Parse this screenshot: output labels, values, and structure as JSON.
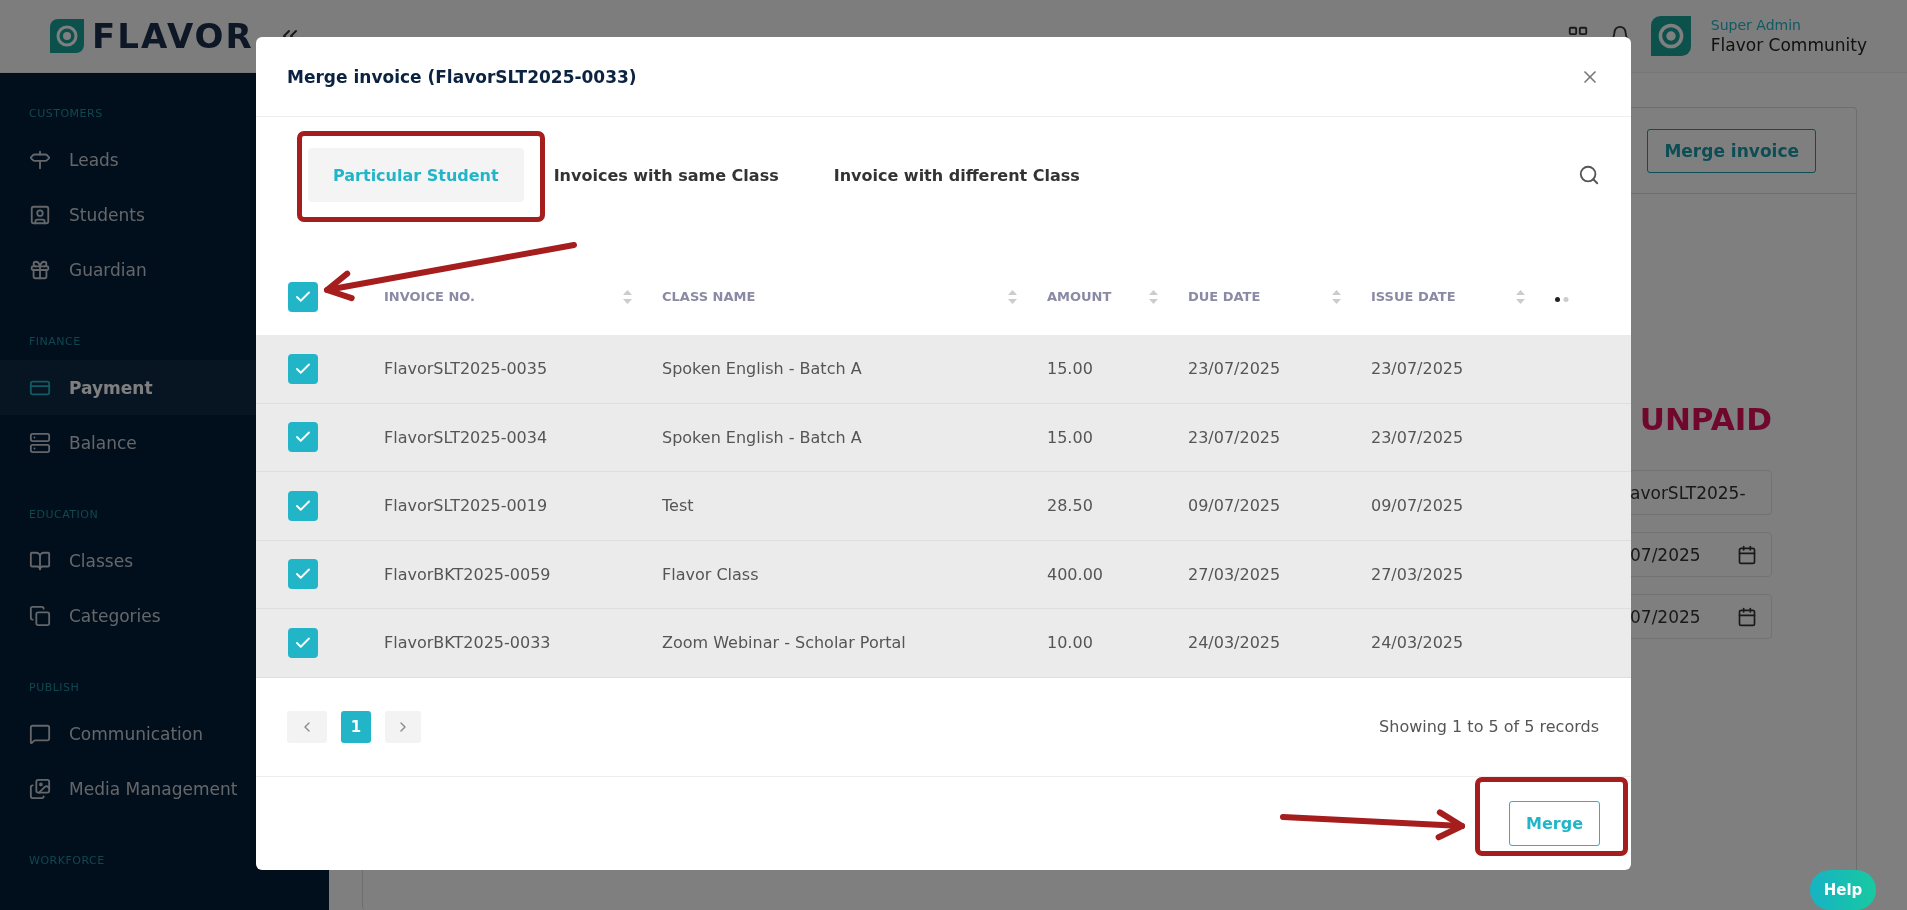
{
  "brand": {
    "logo_text": "FLAVOR"
  },
  "header": {
    "user_role": "Super Admin",
    "user_name": "Flavor Community"
  },
  "sidebar": {
    "sections": [
      {
        "title": "CUSTOMERS",
        "items": [
          {
            "label": "Leads",
            "selected": false
          },
          {
            "label": "Students",
            "selected": false
          },
          {
            "label": "Guardian",
            "selected": false
          }
        ]
      },
      {
        "title": "FINANCE",
        "items": [
          {
            "label": "Payment",
            "selected": true
          },
          {
            "label": "Balance",
            "selected": false
          }
        ]
      },
      {
        "title": "EDUCATION",
        "items": [
          {
            "label": "Classes",
            "selected": false
          },
          {
            "label": "Categories",
            "selected": false
          }
        ]
      },
      {
        "title": "PUBLISH",
        "items": [
          {
            "label": "Communication",
            "selected": false
          },
          {
            "label": "Media Management",
            "selected": false
          }
        ]
      },
      {
        "title": "WORKFORCE"
      }
    ]
  },
  "page": {
    "merge_button": "Merge invoice",
    "status": "UNPAID",
    "fields": [
      {
        "kind": "text",
        "value": "avorSLT2025-"
      },
      {
        "kind": "date",
        "value": "07/2025"
      },
      {
        "kind": "date",
        "value": "07/2025"
      }
    ]
  },
  "modal": {
    "title": "Merge invoice (FlavorSLT2025-0033)",
    "tabs": [
      {
        "label": "Particular Student",
        "selected": true
      },
      {
        "label": "Invoices with same Class",
        "selected": false
      },
      {
        "label": "Invoice with different Class",
        "selected": false
      }
    ],
    "table": {
      "select_all": {
        "checked": true
      },
      "columns": [
        "INVOICE NO.",
        "CLASS NAME",
        "AMOUNT",
        "DUE DATE",
        "ISSUE DATE"
      ],
      "rows": [
        {
          "checked": true,
          "cells": [
            "FlavorSLT2025-0035",
            "Spoken English - Batch A",
            "15.00",
            "23/07/2025",
            "23/07/2025"
          ]
        },
        {
          "checked": true,
          "cells": [
            "FlavorSLT2025-0034",
            "Spoken English - Batch A",
            "15.00",
            "23/07/2025",
            "23/07/2025"
          ]
        },
        {
          "checked": true,
          "cells": [
            "FlavorSLT2025-0019",
            "Test",
            "28.50",
            "09/07/2025",
            "09/07/2025"
          ]
        },
        {
          "checked": true,
          "cells": [
            "FlavorBKT2025-0059",
            "Flavor Class",
            "400.00",
            "27/03/2025",
            "27/03/2025"
          ]
        },
        {
          "checked": true,
          "cells": [
            "FlavorBKT2025-0033",
            "Zoom Webinar - Scholar Portal",
            "10.00",
            "24/03/2025",
            "24/03/2025"
          ]
        }
      ]
    },
    "pagination": {
      "pages": [
        {
          "label": "1",
          "selected": true
        }
      ],
      "summary": "Showing 1 to 5 of 5 records"
    },
    "footer_button": "Merge"
  },
  "help_button": "Help"
}
